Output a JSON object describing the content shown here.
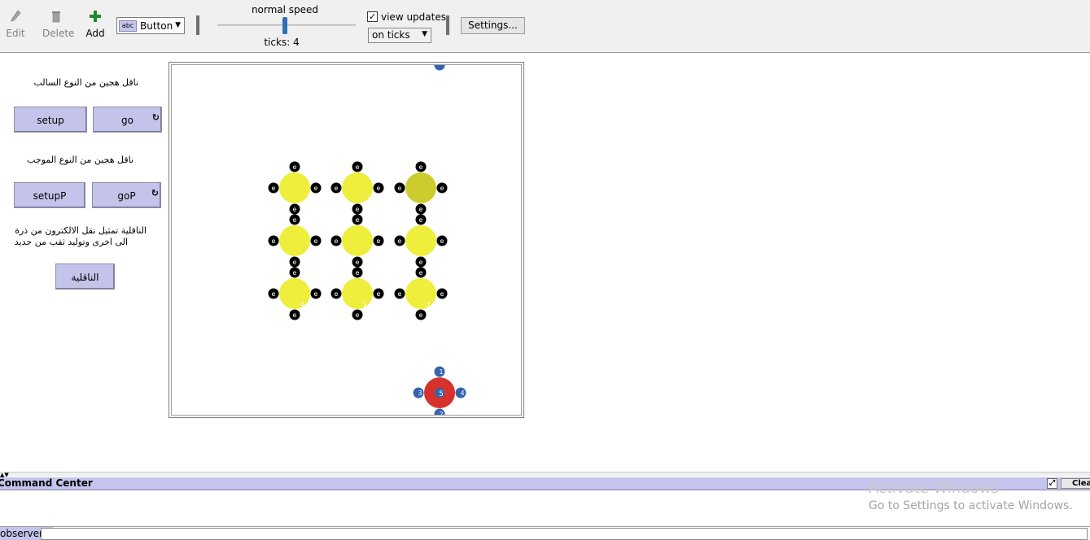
{
  "toolbar": {
    "edit_label": "Edit",
    "delete_label": "Delete",
    "add_label": "Add",
    "widget_type": "Button",
    "widget_icon_text": "abc",
    "speed_label": "normal speed",
    "speed_value": 0.49,
    "ticks_label": "ticks: 4",
    "view_updates_label": "view updates",
    "view_updates_checked": true,
    "update_mode": "on ticks",
    "settings_label": "Settings..."
  },
  "interface": {
    "note1": "ناقل هجين من النوع السالب",
    "setup_label": "setup",
    "go_label": "go",
    "note2": "ناقل هجين من النوع الموجب",
    "setupP_label": "setupP",
    "goP_label": "goP",
    "note3_line1": "الناقلية تمثيل نقل الالكترون من ذرة",
    "note3_line2": "الى اخرى وتوليد ثقب من جديد",
    "conductivity_label": "الناقلية",
    "forever_icon": "↻"
  },
  "world": {
    "electron_label": "e",
    "yellow_color": "#eeee3c",
    "dim_yellow_color": "#cccc2e",
    "red_color": "#d7312b",
    "blue_color": "#3563ae",
    "atom_numbers": [
      "4",
      "1",
      "7"
    ],
    "center_atom_number": "5",
    "blue_labels": [
      "1",
      "3",
      "4",
      "2"
    ]
  },
  "command_center": {
    "title": "Command Center",
    "clear_label": "Clear",
    "expand_icon": "⤢",
    "observer_label": "observer>",
    "input_value": ""
  },
  "watermark": {
    "line1": "Activate Windows",
    "line2": "Go to Settings to activate Windows."
  }
}
